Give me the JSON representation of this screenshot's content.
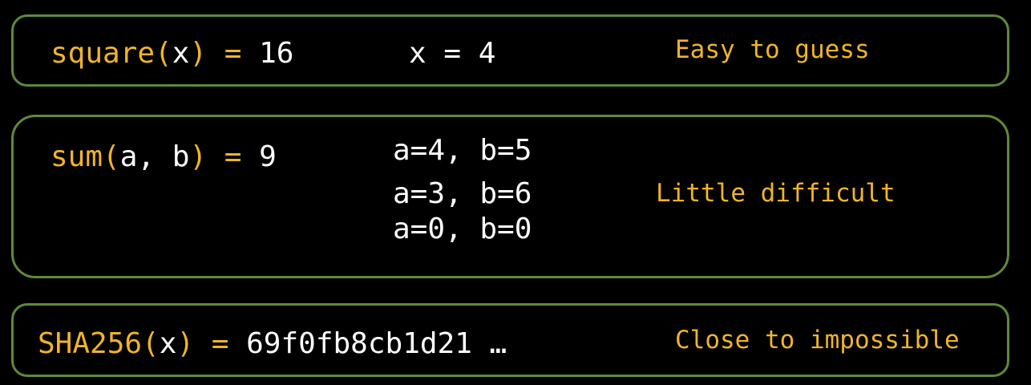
{
  "rows": [
    {
      "fn_name": "square(",
      "arg": "x",
      "close": ")",
      "eq": " = ",
      "result": "16",
      "solutions": [
        "x = 4"
      ],
      "note": "Easy to guess"
    },
    {
      "fn_name": "sum(",
      "arg": "a, b",
      "close": ")",
      "eq": " = ",
      "result": "9",
      "solutions": [
        "a=4, b=5",
        "a=3, b=6",
        "a=0, b=0"
      ],
      "note": "Little difficult"
    },
    {
      "fn_name": "SHA256(",
      "arg": "x",
      "close": ")",
      "eq": " = ",
      "result": "69f0fb8cb1d21 …",
      "solutions": [],
      "note": "Close to impossible"
    }
  ],
  "colors": {
    "accent": "#f0b429",
    "text": "#ffffff",
    "border": "#5e8a3a",
    "background": "#000000"
  }
}
